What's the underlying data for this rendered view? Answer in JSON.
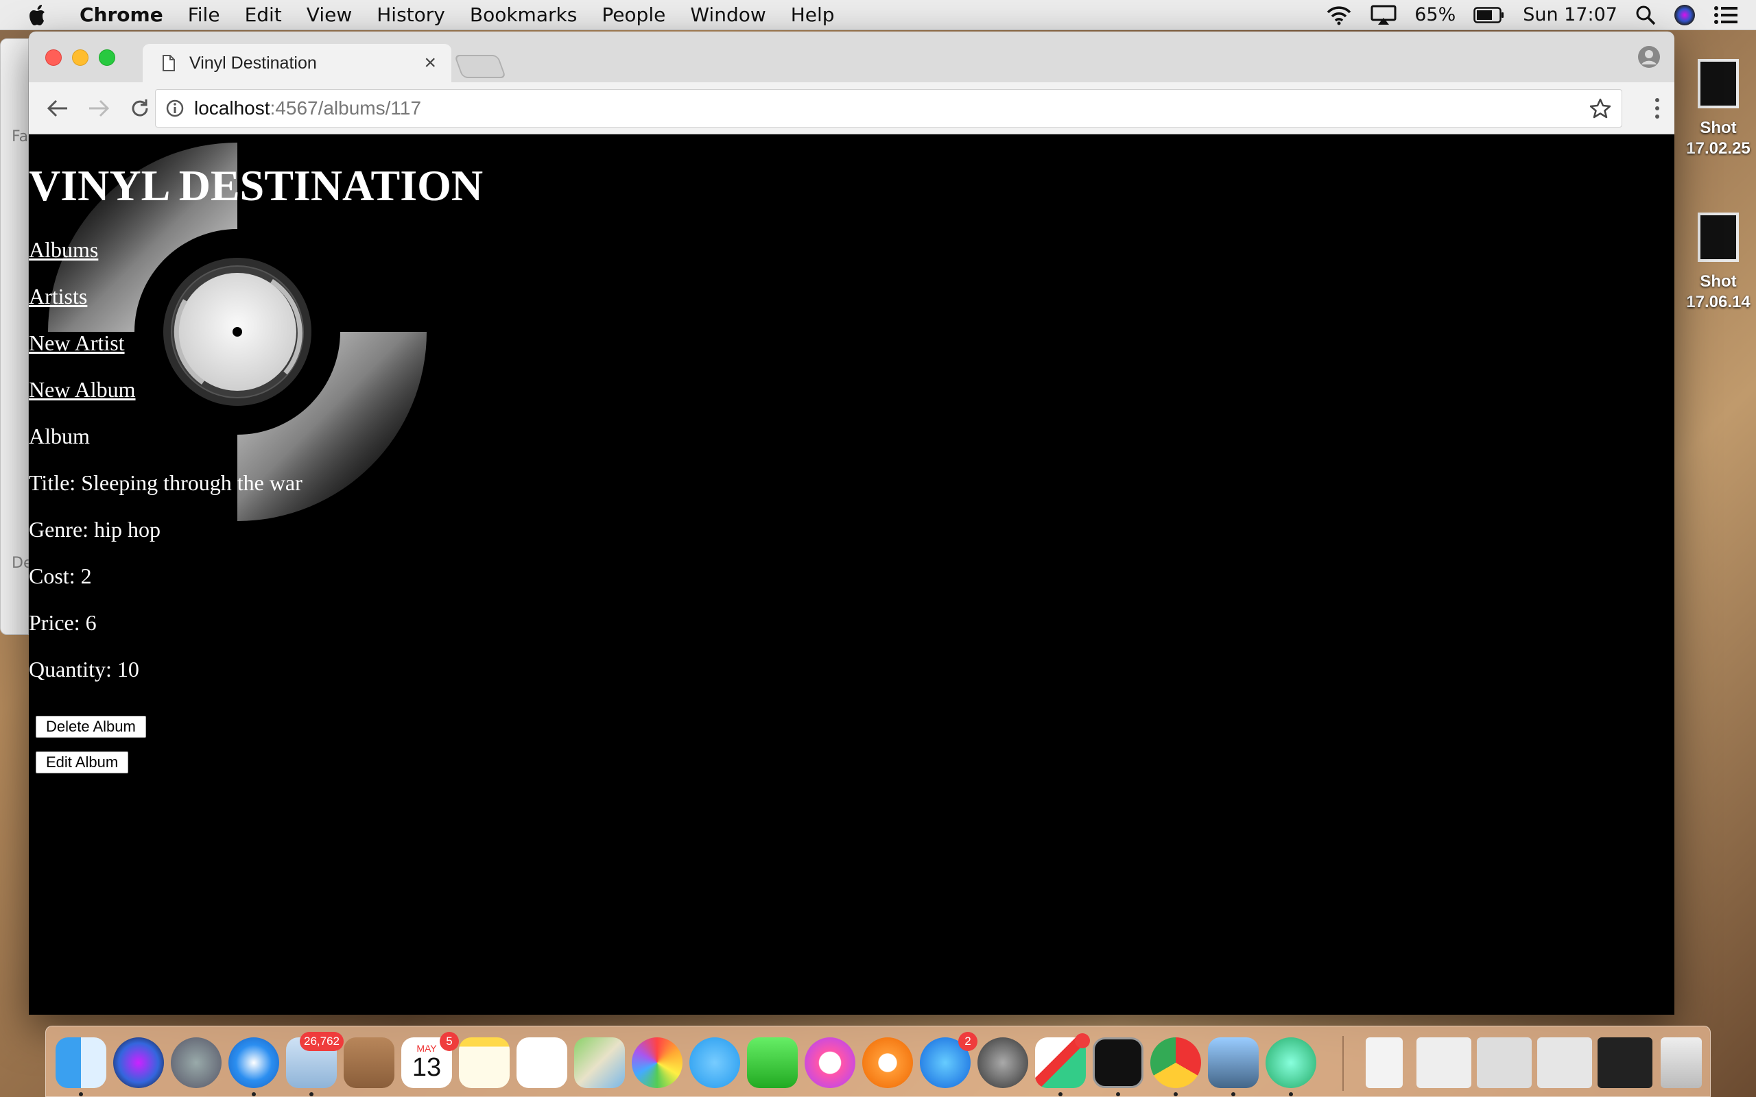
{
  "menubar": {
    "app_name": "Chrome",
    "menus": [
      "File",
      "Edit",
      "View",
      "History",
      "Bookmarks",
      "People",
      "Window",
      "Help"
    ],
    "battery": "65%",
    "clock": "Sun 17:07"
  },
  "desktop": {
    "files": [
      {
        "line1": "Shot",
        "line2": "17.02.25"
      },
      {
        "line1": "Shot",
        "line2": "17.06.14"
      }
    ],
    "finder_fragments": [
      "Fa",
      "De"
    ]
  },
  "browser": {
    "tab_title": "Vinyl Destination",
    "url_host": "localhost",
    "url_rest": ":4567/albums/117"
  },
  "page": {
    "site_title": "VINYL DESTINATION",
    "nav": [
      "Albums",
      "Artists",
      "New Artist",
      "New Album"
    ],
    "section_label": "Album",
    "details": {
      "title": "Title: Sleeping through the war",
      "genre": "Genre: hip hop",
      "cost": "Cost: 2",
      "price": "Price: 6",
      "quantity": "Quantity: 10"
    },
    "buttons": {
      "delete": "Delete Album",
      "edit": "Edit Album"
    }
  },
  "dock": {
    "apps": [
      "finder",
      "siri",
      "launchpad",
      "safari",
      "mail",
      "contacts",
      "calendar",
      "notes",
      "reminders",
      "maps",
      "photos",
      "messages",
      "facetime",
      "itunes",
      "ibooks",
      "app-store",
      "system-preferences",
      "slack",
      "terminal",
      "chrome",
      "preview",
      "atom"
    ],
    "mail_badge": "26,762",
    "calendar_badge": "5",
    "calendar_month": "MAY",
    "calendar_day": "13",
    "appstore_badge": "2"
  },
  "colors": {
    "page_background": "#000000",
    "page_text": "#ffffff",
    "traffic_close": "#ff5f57",
    "traffic_min": "#ffbd2e",
    "traffic_max": "#28c940",
    "badge": "#ef3c3c"
  }
}
